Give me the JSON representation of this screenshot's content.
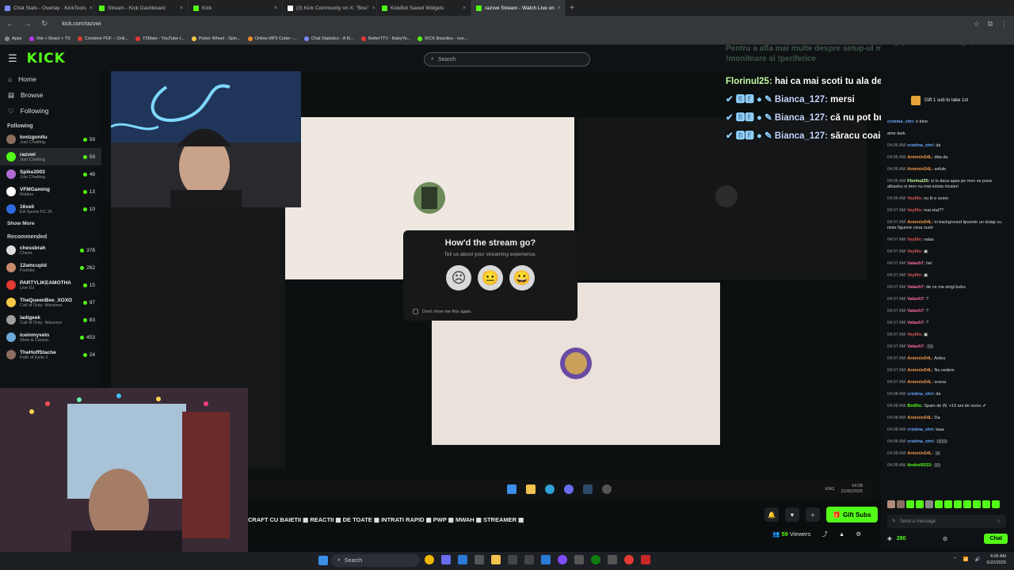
{
  "tabs": [
    {
      "label": "Chat Stats - Overlay - KickTools",
      "color": "#7a8cff",
      "active": false
    },
    {
      "label": "Stream - Kick Dashboard",
      "color": "#53fc18",
      "active": false
    },
    {
      "label": "Kick",
      "color": "#53fc18",
      "active": false
    },
    {
      "label": "(3) Kick Community on X: \"Bou\"",
      "color": "#ffffff",
      "active": false
    },
    {
      "label": "KickBot Saved Widgets",
      "color": "#53fc18",
      "active": false
    },
    {
      "label": "razvwi Stream - Watch Live on",
      "color": "#53fc18",
      "active": true
    }
  ],
  "address": {
    "url": "kick.com/razvwi"
  },
  "bookmarks": [
    {
      "label": "Apps",
      "color": "#888888"
    },
    {
      "label": "Vite + React + TS",
      "color": "#bd34fe"
    },
    {
      "label": "Combine PDF – Onli...",
      "color": "#e53935"
    },
    {
      "label": "Y2Mate - YouTube t...",
      "color": "#e53935"
    },
    {
      "label": "Picker Wheel - Spin...",
      "color": "#f7c948"
    },
    {
      "label": "Online MP3 Cutter -...",
      "color": "#f28c28"
    },
    {
      "label": "Chat Statistics - A Ki...",
      "color": "#7a8cff"
    },
    {
      "label": "BetterTTV - BabyYo...",
      "color": "#e53935"
    },
    {
      "label": "KICK Bounties - eve...",
      "color": "#53fc18"
    }
  ],
  "header": {
    "logo": "KICK",
    "search_placeholder": "Search"
  },
  "nav": [
    {
      "label": "Home",
      "icon": "home-icon"
    },
    {
      "label": "Browse",
      "icon": "browse-icon"
    },
    {
      "label": "Following",
      "icon": "heart-icon"
    }
  ],
  "following_title": "Following",
  "following": [
    {
      "name": "Ionizgonitu",
      "category": "Just Chatting",
      "viewers": "59",
      "color": "#8a6d5b"
    },
    {
      "name": "razvwi",
      "category": "Just Chatting",
      "viewers": "59",
      "color": "#53fc18",
      "selected": true
    },
    {
      "name": "Spike2003",
      "category": "Just Chatting",
      "viewers": "48",
      "color": "#b06bd6"
    },
    {
      "name": "VFMGaming",
      "category": "Roblox",
      "viewers": "13",
      "color": "#ffffff"
    },
    {
      "name": "16veli",
      "category": "EA Sports FC 25",
      "viewers": "10",
      "color": "#2d6cdf"
    }
  ],
  "show_more": "Show More",
  "recommended_title": "Recommended",
  "recommended": [
    {
      "name": "chessbrah",
      "category": "Chess",
      "viewers": "378",
      "color": "#dddddd"
    },
    {
      "name": "12amcupid",
      "category": "Fortnite",
      "viewers": "262",
      "color": "#c98b6b"
    },
    {
      "name": "PARTYLIKEAMOTHA",
      "category": "Live DJ",
      "viewers": "15",
      "color": "#e53935"
    },
    {
      "name": "TheQueenBee_XOXO",
      "category": "Call of Duty: Warzone",
      "viewers": "97",
      "color": "#f7c948"
    },
    {
      "name": "iadigeek",
      "category": "Call of Duty: Warzone",
      "viewers": "83",
      "color": "#a0a0a0"
    },
    {
      "name": "iceinmyvein",
      "category": "Slots & Casino",
      "viewers": "453",
      "color": "#6ba8d9"
    },
    {
      "name": "TheHoffStache",
      "category": "Path of Exile 2",
      "viewers": "24",
      "color": "#8d6e63"
    }
  ],
  "modal": {
    "title": "How'd the stream go?",
    "subtitle": "Tell us about your streaming experience.",
    "faces": [
      "☹",
      "😐",
      "😀"
    ],
    "dont_show": "Don't show me this again."
  },
  "overlay_faded": "Pentru a afla mai multe despre setup-ul meu foloseste comenzile !pc, !monitoare si !periferice",
  "overlay_chat": [
    {
      "user": "Florinul25:",
      "message": "hai ca mai scoti tu ala de acolo vreodata",
      "badges": ""
    },
    {
      "user": "Bianca_127:",
      "message": "mersi",
      "badges": "✔ 🅱🅴 ● ✎"
    },
    {
      "user": "Bianca_127:",
      "message": "că nu pot bro nuj dc",
      "badges": "✔ 🅱🅴 ● ✎"
    },
    {
      "user": "Bianca_127:",
      "message": "săracu coaie e traumatizat",
      "badges": "✔ 🅱🅴 ● ✎"
    }
  ],
  "ticker": "CRAFT CU BAIETII ▦ REACTII ▦ DE TOATE ▦ INTRATI RAPID ▦ PWP ▦ MWAH ▦ STREAMER ▦",
  "gift_subs": "Gift Subs",
  "viewers": {
    "count": "59",
    "label": "Viewers"
  },
  "windows_taskbar_inner": {
    "lang": "ENG",
    "time": "04:08",
    "date": "22/06/2025"
  },
  "chat": {
    "gift_banner": "Gift 1 sub to take 1st",
    "messages": [
      {
        "time": "",
        "user": "cristina_chri:",
        "text": "e bine",
        "color": "#6ba8ff"
      },
      {
        "time": "",
        "user": "",
        "text": "ame dark",
        "color": "#ddd"
      },
      {
        "time": "04:06 AM",
        "user": "cristina_chri:",
        "text": "da",
        "color": "#6ba8ff"
      },
      {
        "time": "04:06 AM",
        "user": "AntonioS4L:",
        "text": "dda da",
        "color": "#f2994a"
      },
      {
        "time": "04:06 AM",
        "user": "AntonioS4L:",
        "text": "sefule",
        "color": "#f2994a"
      },
      {
        "time": "04:06 AM",
        "user": "Florinul25:",
        "text": "si io daca apas pe mov se pune albastru si mov nu mai exista nicaieri",
        "color": "#c6ffa8"
      },
      {
        "time": "04:06 AM",
        "user": "Veyl0n:",
        "text": "nu iti e somn",
        "color": "#e05a5a"
      },
      {
        "time": "04:07 AM",
        "user": "Veyl0n:",
        "text": "mai stai??",
        "color": "#e05a5a"
      },
      {
        "time": "04:07 AM",
        "user": "AntonioS4L:",
        "text": "in background lipseste un dulap cu niste figurine ceva nush",
        "color": "#f2994a"
      },
      {
        "time": "04:07 AM",
        "user": "Veyl0n:",
        "text": "valas",
        "color": "#e05a5a"
      },
      {
        "time": "04:07 AM",
        "user": "Veyl0n:",
        "text": "▣",
        "color": "#e05a5a"
      },
      {
        "time": "04:07 AM",
        "user": "Valash7:",
        "text": "hei",
        "color": "#ff6fa0"
      },
      {
        "time": "04:07 AM",
        "user": "Veyl0n:",
        "text": "▣",
        "color": "#e05a5a"
      },
      {
        "time": "04:07 AM",
        "user": "Valash7:",
        "text": "de ce ma strigi bubu",
        "color": "#ff6fa0"
      },
      {
        "time": "04:07 AM",
        "user": "Valash7:",
        "text": "?",
        "color": "#ff6fa0"
      },
      {
        "time": "04:07 AM",
        "user": "Valash7:",
        "text": "?",
        "color": "#ff6fa0"
      },
      {
        "time": "04:07 AM",
        "user": "Valash7:",
        "text": "?",
        "color": "#ff6fa0"
      },
      {
        "time": "04:07 AM",
        "user": "Veyl0n:",
        "text": "▣",
        "color": "#e05a5a"
      },
      {
        "time": "04:07 AM",
        "user": "Valash7:",
        "text": ":))))",
        "color": "#ff6fa0"
      },
      {
        "time": "04:07 AM",
        "user": "AntonioS4L:",
        "text": "Aoleu",
        "color": "#f2994a"
      },
      {
        "time": "04:07 AM",
        "user": "AntonioS4L:",
        "text": "Nu vedem",
        "color": "#f2994a"
      },
      {
        "time": "04:07 AM",
        "user": "AntonioS4L:",
        "text": "scena",
        "color": "#f2994a"
      },
      {
        "time": "04:08 AM",
        "user": "cristina_chri:",
        "text": "da",
        "color": "#6ba8ff"
      },
      {
        "time": "04:08 AM",
        "user": "BotRix:",
        "text": "Spam de W, +10 ani de noroc ✔",
        "color": "#53fc18"
      },
      {
        "time": "04:08 AM",
        "user": "AntonioS4L:",
        "text": "Da",
        "color": "#f2994a"
      },
      {
        "time": "04:08 AM",
        "user": "cristina_chri:",
        "text": "laaa",
        "color": "#6ba8ff"
      },
      {
        "time": "04:08 AM",
        "user": "cristina_chri:",
        "text": ":)))))))",
        "color": "#6ba8ff"
      },
      {
        "time": "04:08 AM",
        "user": "AntonioS4L:",
        "text": ":)))",
        "color": "#f2994a"
      },
      {
        "time": "04:08 AM",
        "user": "Andrei5533:",
        "text": ":))))",
        "color": "#53fc18"
      }
    ],
    "input_placeholder": "Send a message",
    "points": "280",
    "chat_button": "Chat"
  },
  "taskbar": {
    "search": "Search",
    "time": "4:08 AM",
    "date": "6/22/2025"
  }
}
